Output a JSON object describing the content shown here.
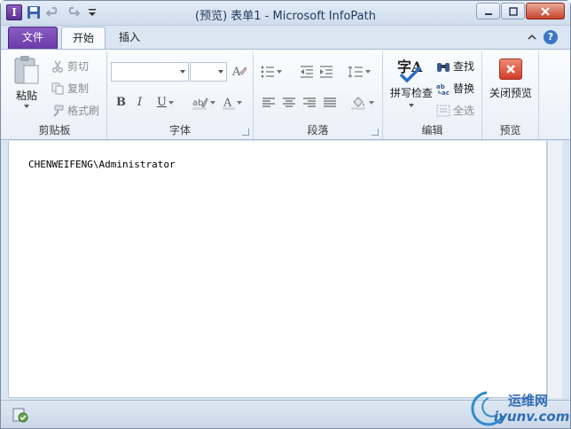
{
  "window": {
    "title": "(预览) 表单1 - Microsoft InfoPath"
  },
  "tabs": {
    "file": "文件",
    "home": "开始",
    "insert": "插入"
  },
  "clipboard": {
    "paste": "粘贴",
    "cut": "剪切",
    "copy": "复制",
    "format_painter": "格式刷",
    "label": "剪贴板"
  },
  "font": {
    "label": "字体",
    "font_name": "",
    "font_size": ""
  },
  "paragraph": {
    "label": "段落"
  },
  "editing": {
    "spell_check": "拼写检查",
    "find": "查找",
    "replace": "替换",
    "select_all": "全选",
    "label": "编辑",
    "spell_glyph": "字A"
  },
  "preview": {
    "close_preview": "关闭预览",
    "label": "预览"
  },
  "document": {
    "user_field": "CHENWEIFENG\\Administrator"
  },
  "watermark": {
    "text_cn": "运维网",
    "text_url": "iyunv.com"
  },
  "colors": {
    "file_tab": "#7042a8",
    "close_button": "#d03c2a",
    "ribbon_border": "#a6b8d2"
  }
}
